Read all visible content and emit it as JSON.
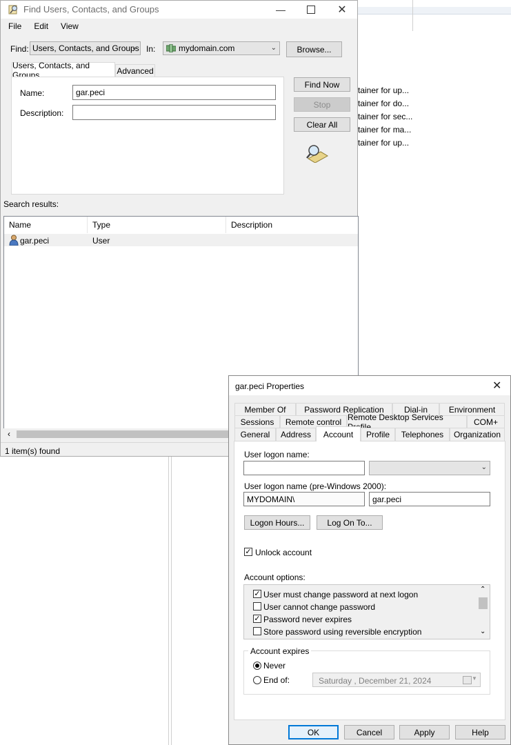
{
  "background": {
    "truncated_items": [
      "tainer for up...",
      "tainer for do...",
      "tainer for sec...",
      "tainer for ma...",
      "tainer for up..."
    ]
  },
  "find_window": {
    "title": "Find Users, Contacts, and Groups",
    "menu": [
      "File",
      "Edit",
      "View"
    ],
    "find_label": "Find:",
    "find_value": "Users, Contacts, and Groups",
    "in_label": "In:",
    "in_value": "mydomain.com",
    "browse_button": "Browse...",
    "tabs": [
      "Users, Contacts, and Groups",
      "Advanced"
    ],
    "name_label": "Name:",
    "name_value": "gar.peci",
    "description_label": "Description:",
    "description_value": "",
    "find_now_button": "Find Now",
    "stop_button": "Stop",
    "clear_all_button": "Clear All",
    "search_results_label": "Search results:",
    "columns": [
      "Name",
      "Type",
      "Description"
    ],
    "rows": [
      {
        "name": "gar.peci",
        "type": "User",
        "description": ""
      }
    ],
    "status": "1 item(s) found"
  },
  "properties": {
    "title": "gar.peci Properties",
    "tabs_row1": [
      "Member Of",
      "Password Replication",
      "Dial-in",
      "Environment"
    ],
    "tabs_row2": [
      "Sessions",
      "Remote control",
      "Remote Desktop Services Profile",
      "COM+"
    ],
    "tabs_row3": [
      "General",
      "Address",
      "Account",
      "Profile",
      "Telephones",
      "Organization"
    ],
    "logon_name_label": "User logon name:",
    "logon_name_value": "",
    "logon_domain_value": "",
    "pre2000_label": "User logon name (pre-Windows 2000):",
    "pre2000_domain": "MYDOMAIN\\",
    "pre2000_user": "gar.peci",
    "logon_hours_button": "Logon Hours...",
    "log_on_to_button": "Log On To...",
    "unlock_label": "Unlock account",
    "unlock_checked": true,
    "account_options_label": "Account options:",
    "account_options": [
      {
        "label": "User must change password at next logon",
        "checked": true
      },
      {
        "label": "User cannot change password",
        "checked": false
      },
      {
        "label": "Password never expires",
        "checked": true
      },
      {
        "label": "Store password using reversible encryption",
        "checked": false
      }
    ],
    "account_expires_label": "Account expires",
    "never_label": "Never",
    "end_of_label": "End of:",
    "end_of_date": "Saturday   , December 21, 2024",
    "ok_button": "OK",
    "cancel_button": "Cancel",
    "apply_button": "Apply",
    "help_button": "Help"
  }
}
